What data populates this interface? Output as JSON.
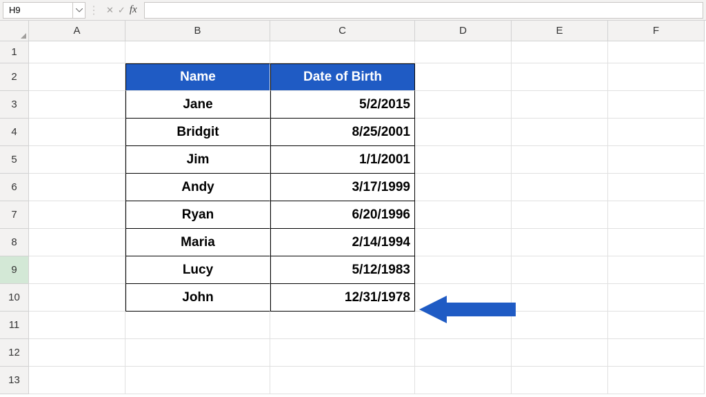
{
  "formula_bar": {
    "name_box": "H9",
    "formula": ""
  },
  "columns": [
    "A",
    "B",
    "C",
    "D",
    "E",
    "F"
  ],
  "rows": [
    "1",
    "2",
    "3",
    "4",
    "5",
    "6",
    "7",
    "8",
    "9",
    "10",
    "11",
    "12",
    "13"
  ],
  "active_row": "9",
  "table": {
    "headers": {
      "name": "Name",
      "dob": "Date of Birth"
    },
    "rows": [
      {
        "name": "Jane",
        "dob": "5/2/2015"
      },
      {
        "name": "Bridgit",
        "dob": "8/25/2001"
      },
      {
        "name": "Jim",
        "dob": "1/1/2001"
      },
      {
        "name": "Andy",
        "dob": "3/17/1999"
      },
      {
        "name": "Ryan",
        "dob": "6/20/1996"
      },
      {
        "name": "Maria",
        "dob": "2/14/1994"
      },
      {
        "name": "Lucy",
        "dob": "5/12/1983"
      },
      {
        "name": "John",
        "dob": "12/31/1978"
      }
    ]
  },
  "arrow_color": "#1f5bc4"
}
